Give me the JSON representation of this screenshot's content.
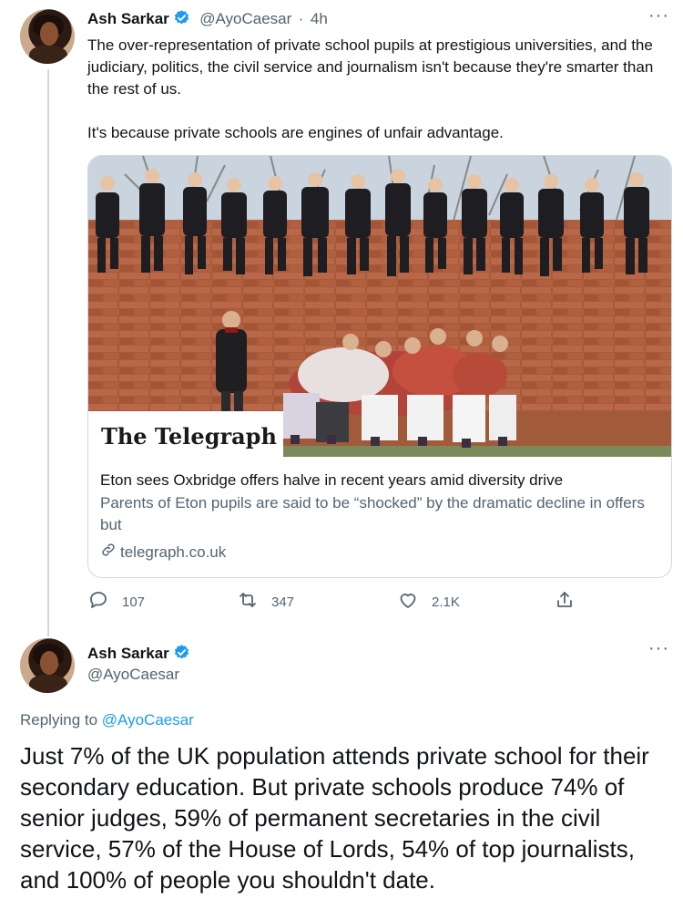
{
  "tweet1": {
    "author_name": "Ash Sarkar",
    "handle": "@AyoCaesar",
    "separator": "·",
    "time": "4h",
    "text_p1": "The over-representation of private school pupils at prestigious universities, and the judiciary, politics, the civil service and journalism isn't because they're smarter than the rest of us.",
    "text_p2": "It's because private schools are engines of unfair advantage.",
    "more_label": "···",
    "card": {
      "publisher_logo": "The Telegraph",
      "title": "Eton sees Oxbridge offers halve in recent years amid diversity drive",
      "description": "Parents of Eton pupils are said to be “shocked” by the dramatic decline in offers but",
      "domain": "telegraph.co.uk",
      "domain_icon": "link-icon"
    },
    "actions": {
      "replies": "107",
      "retweets": "347",
      "likes": "2.1K"
    }
  },
  "tweet2": {
    "author_name": "Ash Sarkar",
    "handle": "@AyoCaesar",
    "more_label": "···",
    "replying_prefix": "Replying to",
    "replying_to": "@AyoCaesar",
    "text": "Just 7% of the UK population attends private school for their secondary education. But private schools produce 74% of senior judges, 59% of permanent secretaries in the civil service, 57% of the House of Lords, 54% of top journalists, and 100% of people you shouldn't date."
  },
  "colors": {
    "verified": "#1d9bf0",
    "link": "#1d9bf0",
    "secondary_text": "#536471",
    "border": "#cfd9de"
  }
}
